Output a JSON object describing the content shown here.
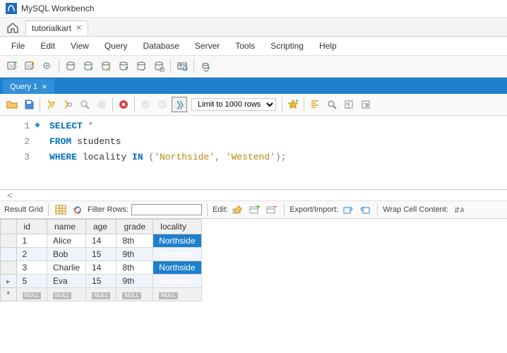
{
  "window": {
    "title": "MySQL Workbench"
  },
  "file_tab": {
    "label": "tutorialkart"
  },
  "menubar": [
    "File",
    "Edit",
    "View",
    "Query",
    "Database",
    "Server",
    "Tools",
    "Scripting",
    "Help"
  ],
  "query_tab": {
    "label": "Query 1"
  },
  "limit": {
    "label": "Limit to 1000 rows"
  },
  "sql": {
    "lines": [
      {
        "n": "1",
        "kw1": "SELECT",
        "rest": " *"
      },
      {
        "n": "2",
        "kw1": "FROM",
        "rest": " students"
      },
      {
        "n": "3",
        "kw1": "WHERE",
        "ident": " locality ",
        "kw2": "IN",
        "paren_open": " (",
        "str1": "'Northside'",
        "comma": ", ",
        "str2": "'Westend'",
        "paren_close": ");"
      }
    ]
  },
  "result_bar": {
    "result_grid": "Result Grid",
    "filter_label": "Filter Rows:",
    "filter_value": "",
    "edit_label": "Edit:",
    "export_label": "Export/Import:",
    "wrap_label": "Wrap Cell Content:"
  },
  "grid": {
    "columns": [
      "id",
      "name",
      "age",
      "grade",
      "locality"
    ],
    "rows": [
      {
        "id": "1",
        "name": "Alice",
        "age": "14",
        "grade": "8th",
        "locality": "Northside"
      },
      {
        "id": "2",
        "name": "Bob",
        "age": "15",
        "grade": "9th",
        "locality": "Westend"
      },
      {
        "id": "3",
        "name": "Charlie",
        "age": "14",
        "grade": "8th",
        "locality": "Northside"
      },
      {
        "id": "5",
        "name": "Eva",
        "age": "15",
        "grade": "9th",
        "locality": "Westend"
      }
    ],
    "null_label": "NULL"
  }
}
